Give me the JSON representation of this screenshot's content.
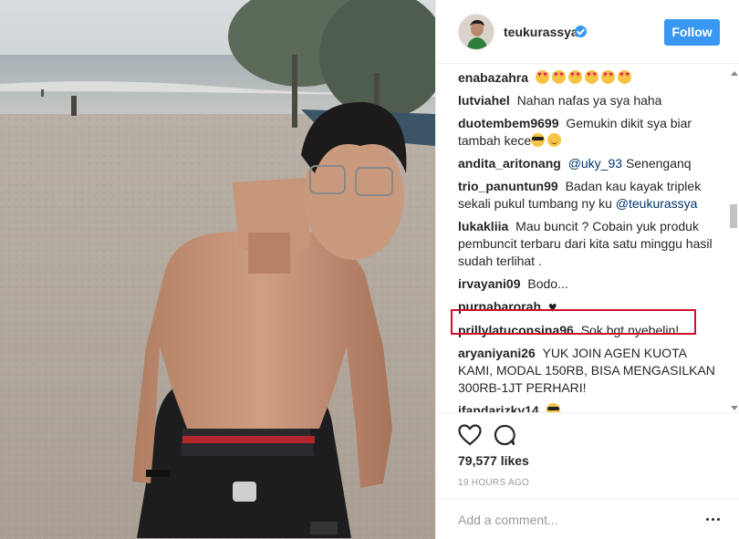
{
  "post": {
    "username": "teukurassya",
    "follow_label": "Follow",
    "likes": "79,577 likes",
    "timestamp": "19 HOURS AGO",
    "add_comment_placeholder": "Add a comment..."
  },
  "comments": [
    {
      "user": "enabazahra",
      "parts": [],
      "emojis": [
        "heart-eyes",
        "heart-eyes",
        "heart-eyes",
        "heart-eyes",
        "heart-eyes",
        "heart-eyes"
      ]
    },
    {
      "user": "lutviahel",
      "text": "Nahan nafas ya sya haha"
    },
    {
      "user": "duotembem9699",
      "text": "Gemukin dikit sya biar tambah kece",
      "emojis_after": [
        "sunglasses-face",
        "smile"
      ]
    },
    {
      "user": "andita_aritonang",
      "mention": "@uky_93",
      "text": "Senenganq"
    },
    {
      "user": "trio_panuntun99",
      "text": "Badan kau kayak triplek sekali pukul tumbang ny ku",
      "mention_after": "@teukurassya"
    },
    {
      "user": "lukakliia",
      "text": "Mau buncit ? Cobain yuk produk pembuncit terbaru dari kita satu minggu hasil sudah terlihat ."
    },
    {
      "user": "irvayani09",
      "text": "Bodo..."
    },
    {
      "user": "purnabarorah",
      "text": "",
      "emojis_after": [
        "black-heart"
      ]
    },
    {
      "user": "prillylatuconsina96",
      "text": "Sok bgt nyebelin!"
    },
    {
      "user": "aryaniyani26",
      "text": "YUK JOIN AGEN KUOTA KAMI, MODAL 150RB, BISA MENGASILKAN 300RB-1JT PERHARI!"
    },
    {
      "user": "ifandarizky14",
      "text": "",
      "emojis_after": [
        "sunglasses-face"
      ]
    }
  ],
  "colors": {
    "accent": "#3897f0",
    "highlight_border": "#d0112b",
    "text": "#262626",
    "muted": "#999999"
  },
  "icons": [
    "verified-badge-icon",
    "heart-icon",
    "comment-icon",
    "more-options-icon",
    "heart-eyes-emoji",
    "sunglasses-emoji",
    "smile-emoji",
    "black-heart-emoji"
  ]
}
